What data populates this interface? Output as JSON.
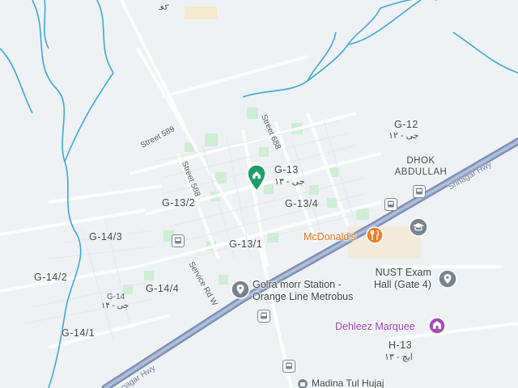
{
  "map": {
    "colors": {
      "background": "#eef2f4",
      "river": "#3fa6d8",
      "highway": "#8a9bbf",
      "road": "#ffffff",
      "park": "#cdeed3",
      "commercial": "#f6e6c6",
      "pin_green": "#1e9e6a",
      "poi_orange": "#e8812a",
      "poi_purple": "#a24db5",
      "poi_gray": "#78858d"
    },
    "sectors": [
      {
        "name": "G-13",
        "urdu": "جی - ۱۳"
      },
      {
        "name": "G-12",
        "urdu": "جی - ۱۲"
      },
      {
        "name": "G-13/2"
      },
      {
        "name": "G-13/4"
      },
      {
        "name": "G-13/1"
      },
      {
        "name": "G-14/3"
      },
      {
        "name": "G-14/2"
      },
      {
        "name": "G-14/4"
      },
      {
        "name": "G-14/1"
      },
      {
        "name": "G-14",
        "urdu": "جی - ۱۴"
      },
      {
        "name": "H-13",
        "urdu": "ایچ - ۱۳"
      },
      {
        "name": "DHOK ABDULLAH"
      }
    ],
    "streets": [
      "Street 589",
      "Street 688",
      "Street 588",
      "Service Rd W",
      "Srinagar Hwy",
      "nagar Hwy"
    ],
    "places": [
      {
        "name": "McDonald's",
        "icon": "restaurant-icon"
      },
      {
        "name": "NUST Exam Hall (Gate 4)",
        "line1": "NUST Exam",
        "line2": "Hall (Gate 4)",
        "icon": "place-icon"
      },
      {
        "name": "Golra morr Station - Orange Line Metrobus",
        "line1": "Golra morr Station -",
        "line2": "Orange Line Metrobus",
        "icon": "transit-station-icon"
      },
      {
        "name": "Dehleez Marquee",
        "icon": "event-venue-icon"
      },
      {
        "name": "Madina Tul Hujaj",
        "icon": "shop-icon"
      }
    ],
    "top_urdu": "کو"
  }
}
